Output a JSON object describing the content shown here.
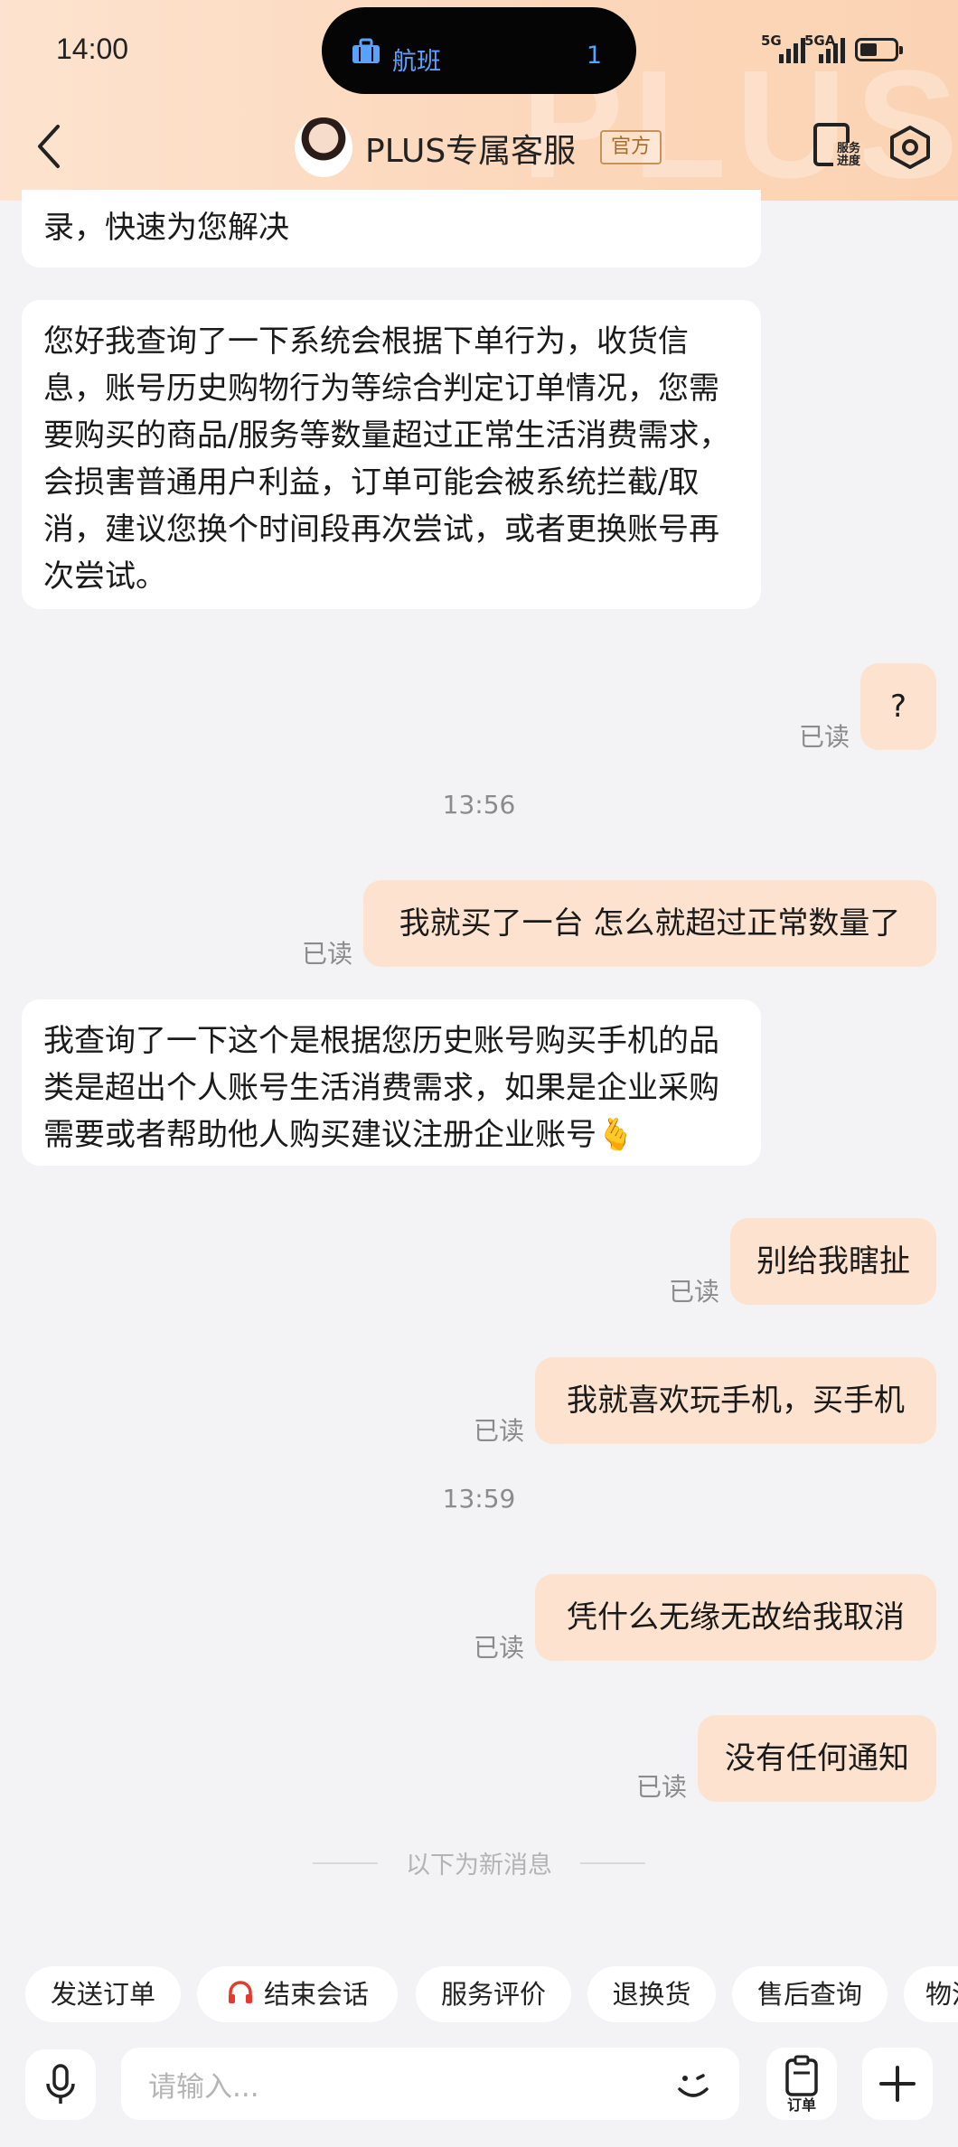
{
  "status_bar": {
    "time": "14:00",
    "island_label": "航班",
    "island_count": "1",
    "signal_1": "5G",
    "signal_2": "5GA"
  },
  "header": {
    "title": "PLUS专属客服",
    "badge": "官方",
    "progress_label": "服务进度",
    "watermark": "PLUS"
  },
  "colors": {
    "accent": "#fcd6b9",
    "user_bubble": "#fde3cf",
    "badge_border": "#c8935a",
    "island_text": "#5aa2ff"
  },
  "messages": {
    "m1": "录，快速为您解决",
    "m2": "您好我查询了一下系统会根据下单行为，收货信息，账号历史购物行为等综合判定订单情况，您需要购买的商品/服务等数量超过正常生活消费需求，会损害普通用户利益，订单可能会被系统拦截/取消，建议您换个时间段再次尝试，或者更换账号再次尝试。",
    "m3": "?",
    "time1": "13:56",
    "m4": "我就买了一台 怎么就超过正常数量了",
    "m5": "我查询了一下这个是根据您历史账号购买手机的品类是超出个人账号生活消费需求，如果是企业采购需要或者帮助他人购买建议注册企业账号",
    "m5_emoji": "🫰",
    "m6": "别给我瞎扯",
    "m7": "我就喜欢玩手机，买手机",
    "time2": "13:59",
    "m8": "凭什么无缘无故给我取消",
    "m9": "没有任何通知",
    "read": "已读",
    "divider": "以下为新消息"
  },
  "quick_actions": [
    "发送订单",
    "结束会话",
    "服务评价",
    "退换货",
    "售后查询",
    "物流"
  ],
  "input": {
    "placeholder": "请输入...",
    "order_label": "订单"
  },
  "icons": [
    "back-arrow-icon",
    "settings-hexagon-icon",
    "headset-icon",
    "microphone-icon",
    "emoji-icon",
    "order-clipboard-icon",
    "plus-icon",
    "suitcase-icon"
  ]
}
